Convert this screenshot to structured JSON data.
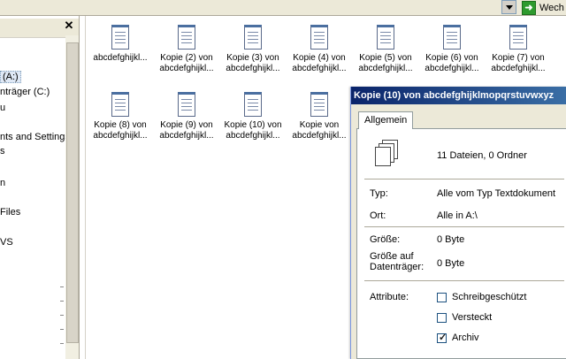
{
  "address_bar": {
    "go_label": "Wech"
  },
  "folder_pane": {
    "items": [
      {
        "label": "(A:)",
        "selected": true
      },
      {
        "label": "nträger (C:)"
      },
      {
        "label": "u"
      },
      {
        "label": "nts and Settings"
      },
      {
        "label": "s"
      },
      {
        "label": "n"
      },
      {
        "label": "Files"
      },
      {
        "label": "VS"
      }
    ]
  },
  "files": [
    {
      "label_line1": "abcdefghijkl...",
      "label_line2": ""
    },
    {
      "label_line1": "Kopie (2) von",
      "label_line2": "abcdefghijkl..."
    },
    {
      "label_line1": "Kopie (3) von",
      "label_line2": "abcdefghijkl..."
    },
    {
      "label_line1": "Kopie (4) von",
      "label_line2": "abcdefghijkl..."
    },
    {
      "label_line1": "Kopie (5) von",
      "label_line2": "abcdefghijkl..."
    },
    {
      "label_line1": "Kopie (6) von",
      "label_line2": "abcdefghijkl..."
    },
    {
      "label_line1": "Kopie (7) von",
      "label_line2": "abcdefghijkl..."
    },
    {
      "label_line1": "Kopie (8) von",
      "label_line2": "abcdefghijkl..."
    },
    {
      "label_line1": "Kopie (9) von",
      "label_line2": "abcdefghijkl..."
    },
    {
      "label_line1": "Kopie (10) von",
      "label_line2": "abcdefghijkl..."
    },
    {
      "label_line1": "Kopie von",
      "label_line2": "abcdefghijkl..."
    }
  ],
  "properties_dialog": {
    "title": "Kopie (10) von abcdefghijklmopqrstuvwxyz",
    "tab_general": "Allgemein",
    "summary": "11 Dateien, 0 Ordner",
    "type_label": "Typ:",
    "type_value": "Alle vom Typ Textdokument",
    "location_label": "Ort:",
    "location_value": "Alle in A:\\",
    "size_label": "Größe:",
    "size_value": "0 Byte",
    "size_on_disk_label": "Größe auf Datenträger:",
    "size_on_disk_value": "0 Byte",
    "attributes_label": "Attribute:",
    "attributes": [
      {
        "label": "Schreibgeschützt",
        "checked": false
      },
      {
        "label": "Versteckt",
        "checked": false
      },
      {
        "label": "Archiv",
        "checked": true
      }
    ]
  }
}
